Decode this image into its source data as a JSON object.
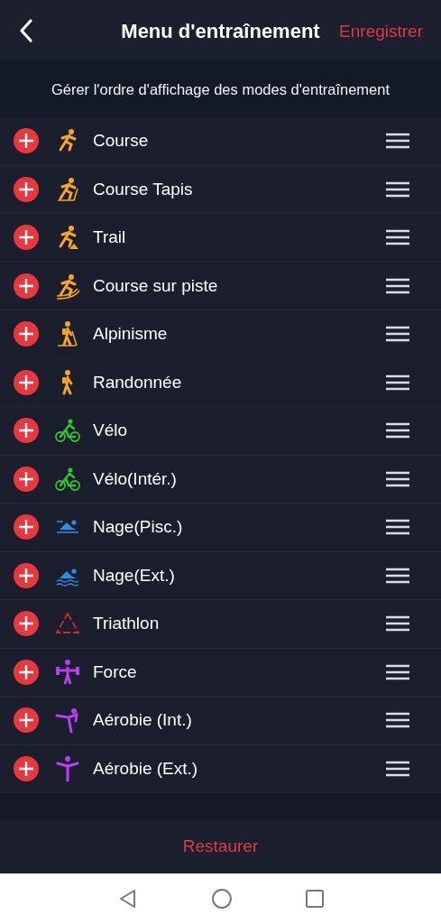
{
  "header": {
    "title": "Menu d'entraînement",
    "save": "Enregistrer"
  },
  "subtitle": "Gérer l'ordre d'affichage des modes d'entraînement",
  "modes": [
    {
      "label": "Course",
      "kind": "run",
      "color": "#f5a623"
    },
    {
      "label": "Course Tapis",
      "kind": "treadmill",
      "color": "#f5a623"
    },
    {
      "label": "Trail",
      "kind": "trail",
      "color": "#f5a623"
    },
    {
      "label": "Course sur piste",
      "kind": "track",
      "color": "#f5a623"
    },
    {
      "label": "Alpinisme",
      "kind": "climb",
      "color": "#f5a623"
    },
    {
      "label": "Randonnée",
      "kind": "hike",
      "color": "#f5a623"
    },
    {
      "label": "Vélo",
      "kind": "bike",
      "color": "#2fc82f"
    },
    {
      "label": "Vélo(Intér.)",
      "kind": "bike",
      "color": "#2fc82f"
    },
    {
      "label": "Nage(Pisc.)",
      "kind": "pool",
      "color": "#2e8ef0"
    },
    {
      "label": "Nage(Ext.)",
      "kind": "swim",
      "color": "#2e8ef0"
    },
    {
      "label": "Triathlon",
      "kind": "triathlon",
      "color": "#d7262e"
    },
    {
      "label": "Force",
      "kind": "strength",
      "color": "#b83ff0"
    },
    {
      "label": "Aérobie (Int.)",
      "kind": "yoga",
      "color": "#b83ff0"
    },
    {
      "label": "Aérobie (Ext.)",
      "kind": "open-arms",
      "color": "#b83ff0"
    }
  ],
  "restore": "Restaurer"
}
